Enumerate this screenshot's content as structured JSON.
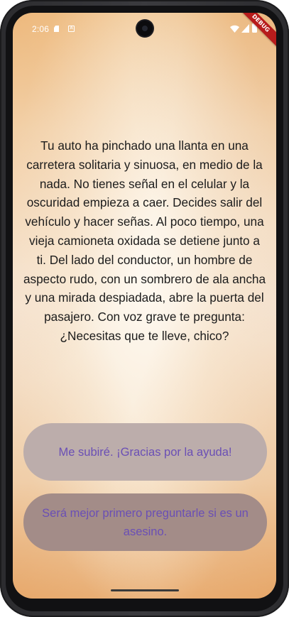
{
  "status_bar": {
    "time": "2:06",
    "icons": [
      "sd-card-icon",
      "a-notification-icon",
      "wifi-icon",
      "signal-icon",
      "battery-icon"
    ],
    "color": "#ffffff"
  },
  "debug_banner": {
    "label": "DEBUG",
    "color": "#b71c1c"
  },
  "story": {
    "text": "Tu auto ha pinchado una llanta en una carretera solitaria y sinuosa, en medio de la nada. No tienes señal en el celular y la oscuridad empieza a caer. Decides salir del vehículo y hacer señas. Al poco tiempo, una vieja camioneta oxidada se detiene junto a ti. Del lado del conductor, un hombre de aspecto rudo, con un sombrero de ala ancha y una mirada despiadada, abre la puerta del pasajero. Con voz grave te pregunta: ¿Necesitas que te lleve, chico?"
  },
  "choices": [
    {
      "label": "Me subiré. ¡Gracias por la ayuda!",
      "background": "#bcadab"
    },
    {
      "label": "Será mejor primero preguntarle si es un asesino.",
      "background": "#a38c88"
    }
  ],
  "colors": {
    "choice_text": "#6a4fb5",
    "story_text": "#1c1c1c"
  }
}
